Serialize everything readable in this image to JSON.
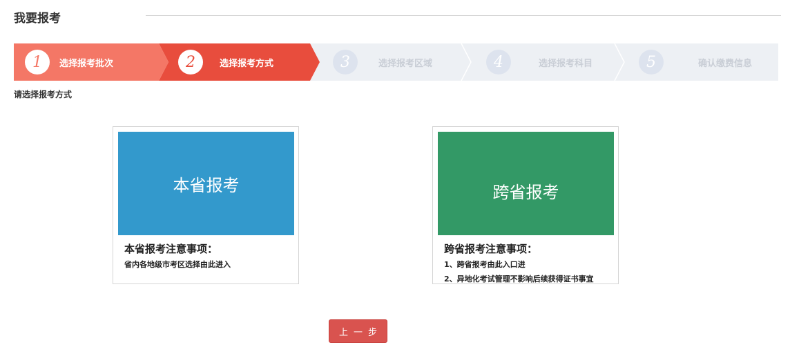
{
  "header": {
    "title": "我要报考"
  },
  "steps": [
    {
      "num": "1",
      "label": "选择报考批次",
      "state": "done"
    },
    {
      "num": "2",
      "label": "选择报考方式",
      "state": "active"
    },
    {
      "num": "3",
      "label": "选择报考区域",
      "state": "todo"
    },
    {
      "num": "4",
      "label": "选择报考科目",
      "state": "todo"
    },
    {
      "num": "5",
      "label": "确认缴费信息",
      "state": "todo"
    }
  ],
  "colors": {
    "step_done": "#f47766",
    "step_active": "#e84d3d",
    "step_todo": "#edf0f4",
    "local_banner": "#3399cc",
    "cross_banner": "#339966",
    "button": "#d9534f"
  },
  "prompt": "请选择报考方式",
  "options": {
    "local": {
      "title": "本省报考",
      "notes_title": "本省报考注意事项：",
      "notes": [
        "省内各地级市考区选择由此进入"
      ]
    },
    "cross": {
      "title": "跨省报考",
      "notes_title": "跨省报考注意事项：",
      "notes": [
        "1、跨省报考由此入口进",
        "2、异地化考试管理不影响后续获得证书事宜"
      ]
    }
  },
  "actions": {
    "prev_label": "上一步"
  }
}
